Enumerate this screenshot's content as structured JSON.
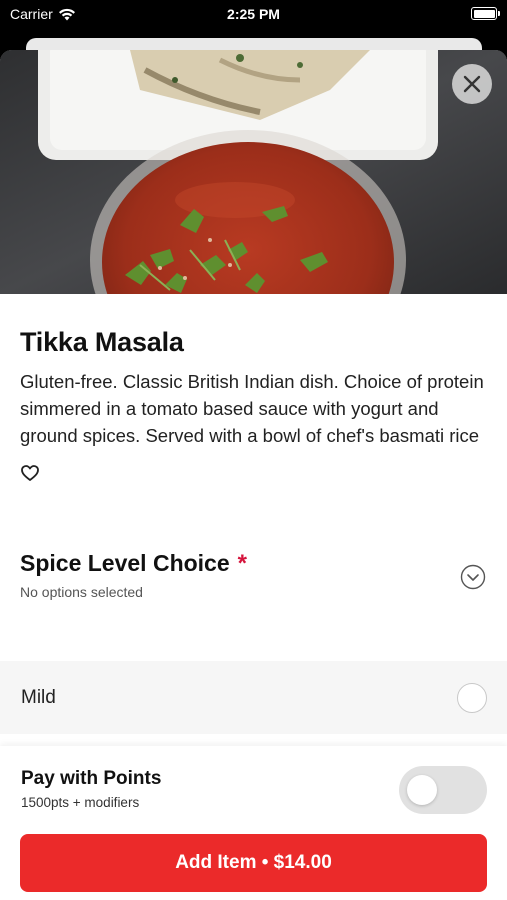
{
  "status_bar": {
    "carrier": "Carrier",
    "time": "2:25 PM"
  },
  "item": {
    "title": "Tikka Masala",
    "description": "Gluten-free. Classic British Indian dish. Choice of protein simmered in a tomato based sauce with yogurt and ground spices. Served with a bowl of chef's basmati rice"
  },
  "modifier_group": {
    "title": "Spice Level Choice",
    "required_mark": "*",
    "subtitle": "No options selected",
    "options": [
      {
        "label": "Mild",
        "selected": false
      }
    ]
  },
  "points": {
    "title": "Pay with Points",
    "subtitle": "1500pts + modifiers",
    "enabled": false
  },
  "cta": {
    "label": "Add Item • $14.00"
  },
  "colors": {
    "accent": "#eb2a2a",
    "required": "#d5143c"
  },
  "icons": {
    "close": "close-icon",
    "favorite": "heart-outline-icon",
    "expand": "chevron-down-circle-icon",
    "wifi": "wifi-icon",
    "battery": "battery-icon"
  }
}
